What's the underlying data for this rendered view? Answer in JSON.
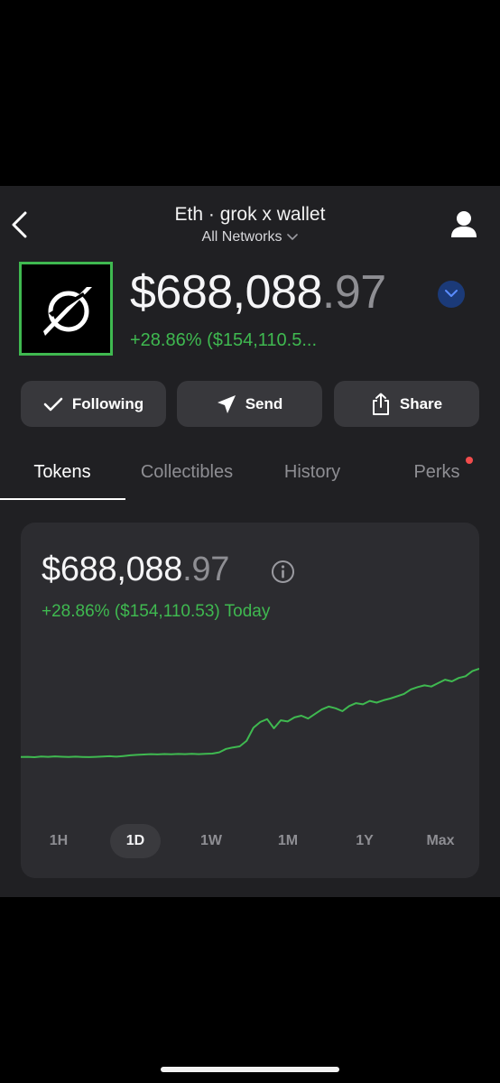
{
  "header": {
    "title": "Eth · grok x wallet",
    "network": "All Networks"
  },
  "portfolio": {
    "balance_whole": "$688,088",
    "balance_cents": ".97",
    "change": "+28.86% ($154,110.5..."
  },
  "actions": [
    {
      "label": "Following",
      "icon": "check-icon"
    },
    {
      "label": "Send",
      "icon": "send-icon"
    },
    {
      "label": "Share",
      "icon": "share-icon"
    }
  ],
  "tabs": [
    {
      "label": "Tokens",
      "active": true
    },
    {
      "label": "Collectibles",
      "active": false
    },
    {
      "label": "History",
      "active": false
    },
    {
      "label": "Perks",
      "active": false,
      "has_notification": true
    }
  ],
  "chart_card": {
    "balance_whole": "$688,088",
    "balance_cents": ".97",
    "change": "+28.86% ($154,110.53) Today",
    "ranges": [
      "1H",
      "1D",
      "1W",
      "1M",
      "1Y",
      "Max"
    ],
    "selected_range": "1D"
  },
  "chart_data": {
    "type": "line",
    "title": "",
    "xlabel": "",
    "ylabel": "",
    "grid": false,
    "series": [
      {
        "color": "#3fb950",
        "values": [
          533978,
          534200,
          533500,
          534600,
          534100,
          534900,
          534300,
          533800,
          534400,
          534000,
          533600,
          534200,
          534800,
          535200,
          534500,
          535500,
          536800,
          537600,
          538200,
          538800,
          538400,
          539000,
          538600,
          539200,
          538800,
          539400,
          538900,
          539300,
          539800,
          542000,
          548000,
          550500,
          552500,
          562000,
          585000,
          595000,
          600000,
          584000,
          598000,
          596000,
          603000,
          606000,
          601000,
          609000,
          617000,
          622000,
          619000,
          614000,
          623000,
          628000,
          626000,
          632000,
          629000,
          633000,
          636000,
          640000,
          644000,
          652000,
          656000,
          659000,
          657000,
          663000,
          669000,
          666000,
          672000,
          675000,
          684000,
          688089
        ]
      }
    ],
    "colors": {
      "line": "#3fb950"
    }
  }
}
